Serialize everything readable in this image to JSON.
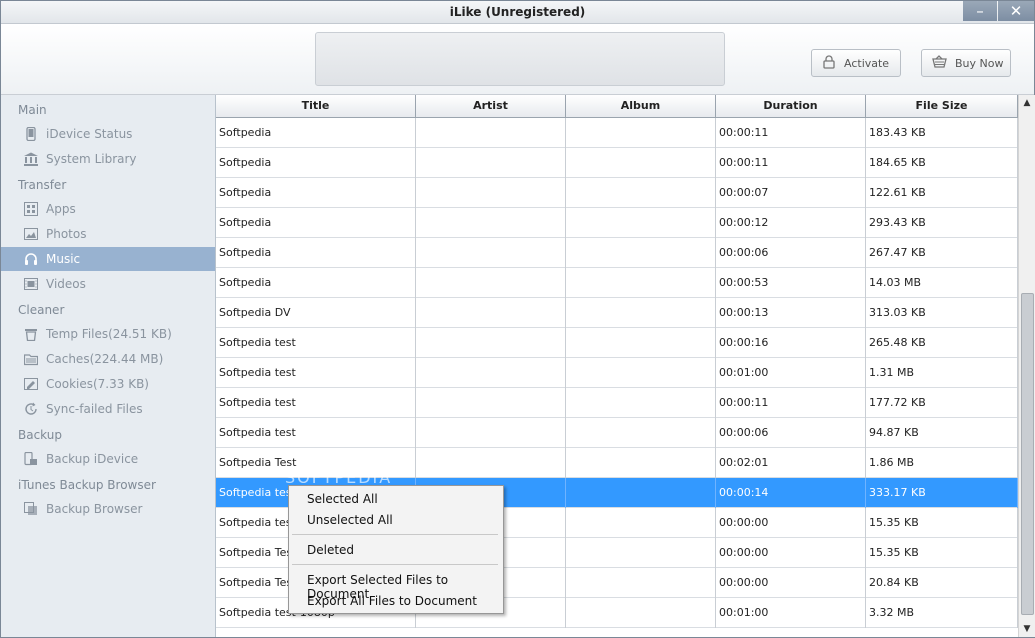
{
  "window": {
    "title": "iLike (Unregistered)",
    "minimize_glyph": "–",
    "close_glyph": "✕"
  },
  "header": {
    "activate_label": "Activate",
    "buy_label": "Buy Now"
  },
  "sidebar": {
    "sections": [
      {
        "label": "Main",
        "items": [
          {
            "label": "iDevice Status",
            "icon": "phone-icon"
          },
          {
            "label": "System Library",
            "icon": "library-icon"
          }
        ]
      },
      {
        "label": "Transfer",
        "items": [
          {
            "label": "Apps",
            "icon": "apps-icon"
          },
          {
            "label": "Photos",
            "icon": "photos-icon"
          },
          {
            "label": "Music",
            "icon": "headphones-icon",
            "selected": true
          },
          {
            "label": "Videos",
            "icon": "film-icon"
          }
        ]
      },
      {
        "label": "Cleaner",
        "items": [
          {
            "label": "Temp Files(24.51 KB)",
            "icon": "trash-icon"
          },
          {
            "label": "Caches(224.44 MB)",
            "icon": "folder-icon"
          },
          {
            "label": "Cookies(7.33 KB)",
            "icon": "cookie-icon"
          },
          {
            "label": "Sync-failed Files",
            "icon": "sync-icon"
          }
        ]
      },
      {
        "label": "Backup",
        "items": [
          {
            "label": "Backup iDevice",
            "icon": "backup-icon"
          }
        ]
      },
      {
        "label": "iTunes Backup Browser",
        "items": [
          {
            "label": "Backup Browser",
            "icon": "browser-icon"
          }
        ]
      }
    ]
  },
  "table": {
    "columns": [
      "Title",
      "Artist",
      "Album",
      "Duration",
      "File Size"
    ],
    "rows": [
      [
        "Softpedia",
        "",
        "",
        "00:00:11",
        "183.43 KB"
      ],
      [
        "Softpedia",
        "",
        "",
        "00:00:11",
        "184.65 KB"
      ],
      [
        "Softpedia",
        "",
        "",
        "00:00:07",
        "122.61 KB"
      ],
      [
        "Softpedia",
        "",
        "",
        "00:00:12",
        "293.43 KB"
      ],
      [
        "Softpedia",
        "",
        "",
        "00:00:06",
        "267.47 KB"
      ],
      [
        "Softpedia",
        "",
        "",
        "00:00:53",
        "14.03 MB"
      ],
      [
        "Softpedia DV",
        "",
        "",
        "00:00:13",
        "313.03 KB"
      ],
      [
        "Softpedia test",
        "",
        "",
        "00:00:16",
        "265.48 KB"
      ],
      [
        "Softpedia test",
        "",
        "",
        "00:01:00",
        "1.31 MB"
      ],
      [
        "Softpedia test",
        "",
        "",
        "00:00:11",
        "177.72 KB"
      ],
      [
        "Softpedia test",
        "",
        "",
        "00:00:06",
        "94.87 KB"
      ],
      [
        "Softpedia Test",
        "",
        "",
        "00:02:01",
        "1.86 MB"
      ],
      [
        "Softpedia test",
        "",
        "",
        "00:00:14",
        "333.17 KB"
      ],
      [
        "Softpedia test",
        "",
        "",
        "00:00:00",
        "15.35 KB"
      ],
      [
        "Softpedia Test",
        "",
        "",
        "00:00:00",
        "15.35 KB"
      ],
      [
        "Softpedia Test",
        "",
        "",
        "00:00:00",
        "20.84 KB"
      ],
      [
        "Softpedia test-1080p",
        "",
        "",
        "00:01:00",
        "3.32 MB"
      ]
    ],
    "selected_row": 12
  },
  "context_menu": {
    "groups": [
      [
        "Selected All",
        "Unselected All"
      ],
      [
        "Deleted"
      ],
      [
        "Export Selected Files to Document",
        "Export All Files to Document"
      ]
    ]
  },
  "watermark": "SOFTPEDIA",
  "colors": {
    "selection": "#3399ff",
    "sidebar_selected": "#98b2d0",
    "sidebar_bg": "#e7ecf1"
  }
}
